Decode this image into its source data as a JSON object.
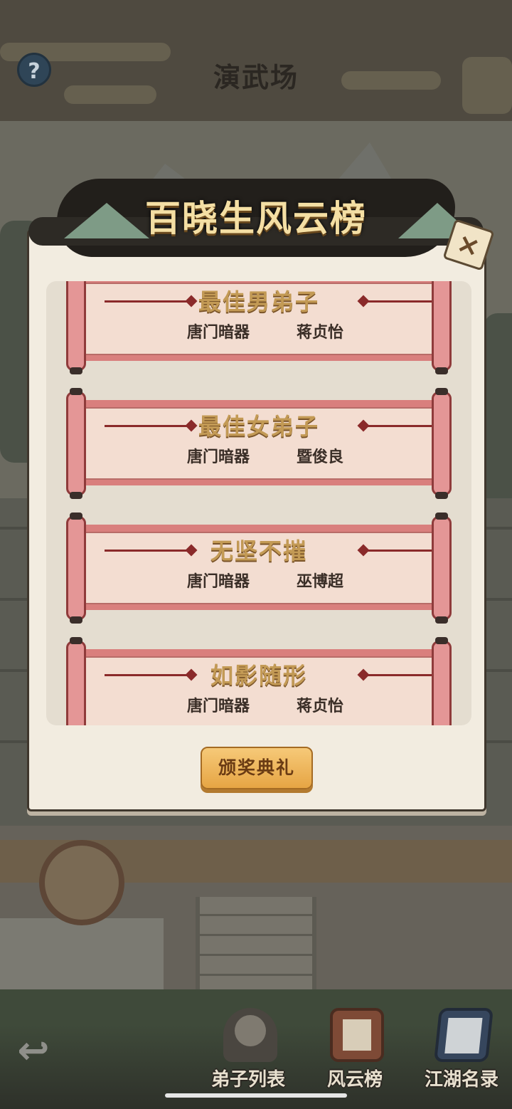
{
  "header": {
    "title": "演武场",
    "help_symbol": "?"
  },
  "modal": {
    "title": "百晓生风云榜",
    "close_symbol": "×",
    "awards": [
      {
        "title": "最佳男弟子",
        "sect": "唐门暗器",
        "name": "蒋贞怡"
      },
      {
        "title": "最佳女弟子",
        "sect": "唐门暗器",
        "name": "暨俊良"
      },
      {
        "title": "无坚不摧",
        "sect": "唐门暗器",
        "name": "巫博超"
      },
      {
        "title": "如影随形",
        "sect": "唐门暗器",
        "name": "蒋贞怡"
      }
    ],
    "ceremony_button": "颁奖典礼"
  },
  "nav": {
    "back_symbol": "↩",
    "items": [
      {
        "label": "弟子列表",
        "icon": "disciple-portrait-icon"
      },
      {
        "label": "风云榜",
        "icon": "ranking-scroll-icon"
      },
      {
        "label": "江湖名录",
        "icon": "book-icon"
      }
    ]
  },
  "colors": {
    "modal_bg": "#f2ece0",
    "scroll_paper": "#f3ddd1",
    "scroll_rod": "#e49696",
    "award_title": "#c39a55",
    "button_gold": "#e6a544",
    "banner_text": "#f4dfa4"
  }
}
